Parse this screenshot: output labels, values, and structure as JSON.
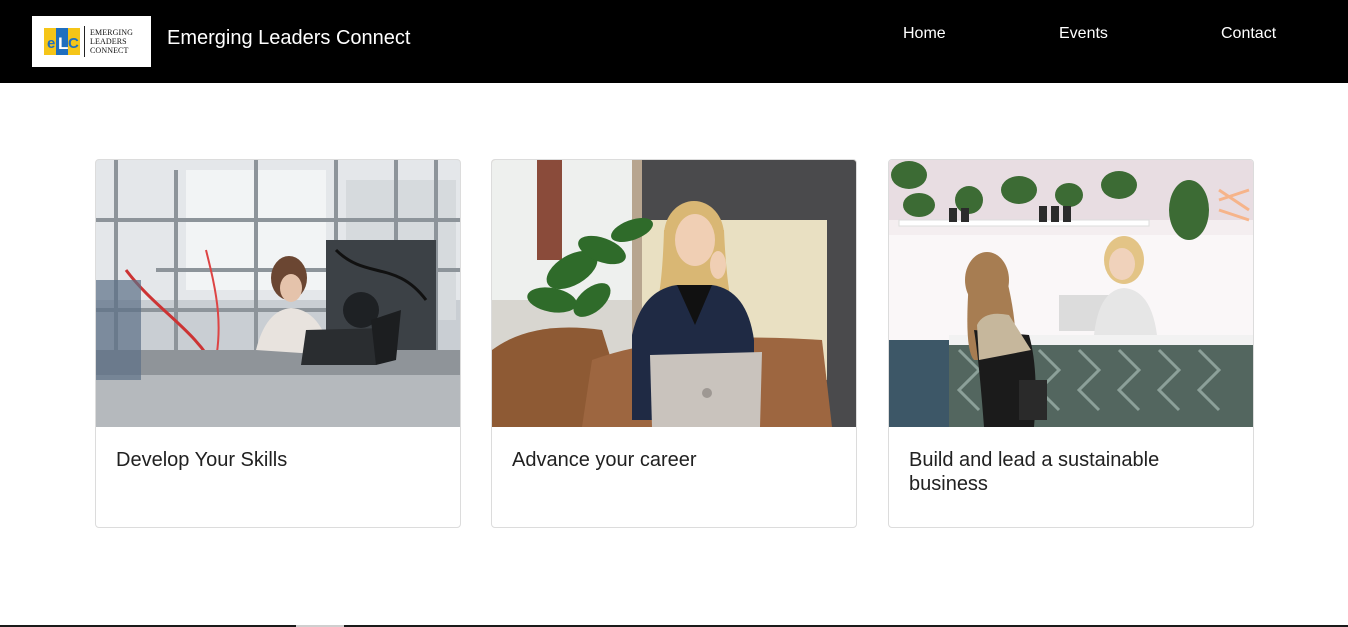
{
  "header": {
    "logo": {
      "mark_text": "eLC",
      "text_lines": [
        "EMERGING",
        "LEADERS",
        "CONNECT"
      ]
    },
    "brand_name": "Emerging Leaders Connect",
    "nav": [
      {
        "label": "Home"
      },
      {
        "label": "Events"
      },
      {
        "label": "Contact"
      }
    ]
  },
  "cards": [
    {
      "title": "Develop Your Skills"
    },
    {
      "title": "Advance your career"
    },
    {
      "title": "Build and lead a sustainable business"
    }
  ],
  "colors": {
    "navbar_bg": "#000000",
    "logo_blue": "#1f6fbf",
    "logo_yellow": "#f5c518",
    "card_border": "#dcdcdc",
    "title_text": "#212121"
  }
}
